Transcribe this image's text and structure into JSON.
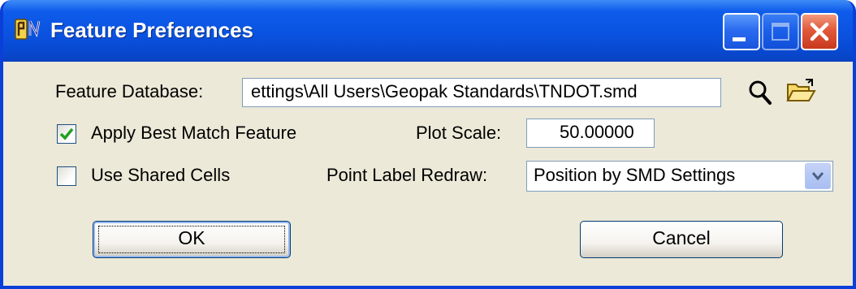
{
  "window": {
    "title": "Feature Preferences",
    "icons": {
      "app": "app-icon",
      "minimize": "minimize-icon",
      "maximize": "maximize-icon",
      "close": "close-icon"
    }
  },
  "form": {
    "feature_database": {
      "label": "Feature Database:",
      "value": "ettings\\All Users\\Geopak Standards\\TNDOT.smd",
      "search_icon": "search-icon",
      "browse_icon": "folder-open-icon"
    },
    "apply_best_match": {
      "label": "Apply Best Match Feature",
      "checked": true
    },
    "plot_scale": {
      "label": "Plot Scale:",
      "value": "50.00000"
    },
    "use_shared_cells": {
      "label": "Use Shared Cells",
      "checked": false
    },
    "point_label_redraw": {
      "label": "Point Label Redraw:",
      "value": "Position by SMD Settings"
    }
  },
  "buttons": {
    "ok": "OK",
    "cancel": "Cancel"
  },
  "colors": {
    "titlebar": "#0A53E0",
    "dialog_bg": "#ECE9D8",
    "close_button": "#E2593B",
    "checkmark": "#21A121"
  }
}
